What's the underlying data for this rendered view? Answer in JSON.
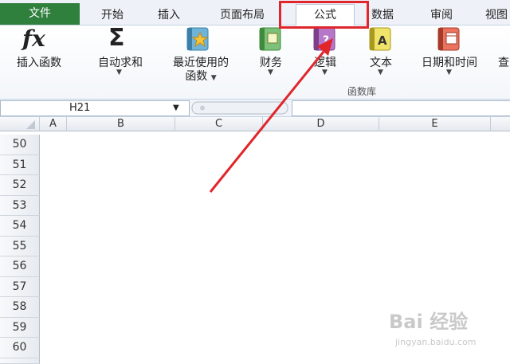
{
  "tabs": {
    "file": "文件",
    "items": [
      "开始",
      "插入",
      "页面布局",
      "公式",
      "数据",
      "审阅",
      "视图"
    ],
    "active": "公式"
  },
  "ribbon": {
    "insert_function": "插入函数",
    "autosum": "自动求和",
    "recent_line1": "最近使用的",
    "recent_line2": "函数",
    "financial": "财务",
    "logical": "逻辑",
    "text": "文本",
    "datetime": "日期和时间",
    "overflow": "查",
    "group_label": "函数库",
    "fx_symbol": "fx",
    "sigma_symbol": "Σ"
  },
  "formula_bar": {
    "name_box": "H21"
  },
  "sheet": {
    "columns": [
      "A",
      "B",
      "C",
      "D",
      "E"
    ],
    "rows": [
      "50",
      "51",
      "52",
      "53",
      "54",
      "55",
      "56",
      "57",
      "58",
      "59",
      "60"
    ]
  },
  "watermark": {
    "main": "Bai 经验",
    "sub": "jingyan.baidu.com"
  },
  "colors": {
    "file_tab": "#2f7f3d",
    "highlight": "#e0262b",
    "arrow": "#e0262b"
  }
}
